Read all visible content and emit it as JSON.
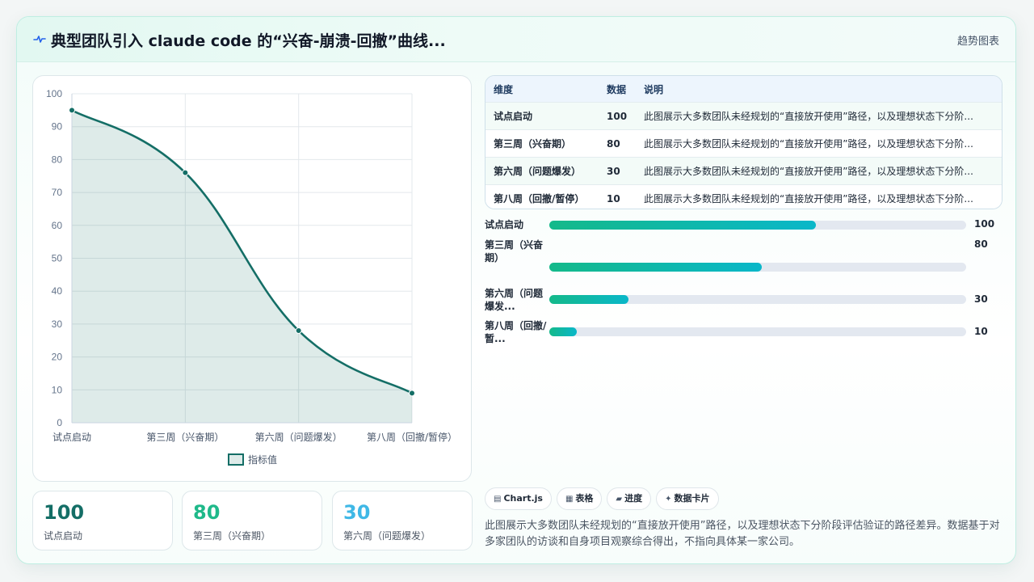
{
  "header": {
    "title": "典型团队引入 claude code 的“兴奋-崩溃-回撤”曲线...",
    "tag": "趋势图表",
    "icon": "pulse-icon"
  },
  "chart_data": {
    "type": "line",
    "fill": "area",
    "categories": [
      "试点启动",
      "第三周（兴奋期）",
      "第六周（问题爆发）",
      "第八周（回撤/暂停）"
    ],
    "series": [
      {
        "name": "指标值",
        "values": [
          95,
          76,
          28,
          9
        ],
        "color": "#146e66"
      }
    ],
    "ylim": [
      0,
      100
    ],
    "yticks": [
      0,
      10,
      20,
      30,
      40,
      50,
      60,
      70,
      80,
      90,
      100
    ],
    "grid": true,
    "legend": "bottom",
    "legend_label": "指标值"
  },
  "stats": [
    {
      "value": "100",
      "label": "试点启动",
      "color": "#146e66"
    },
    {
      "value": "80",
      "label": "第三周（兴奋期）",
      "color": "#1fb98a"
    },
    {
      "value": "30",
      "label": "第六周（问题爆发）",
      "color": "#3fb8e6"
    }
  ],
  "table": {
    "headers": [
      "维度",
      "数据",
      "说明"
    ],
    "rows": [
      [
        "试点启动",
        "100",
        "此图展示大多数团队未经规划的“直接放开使用”路径，以及理想状态下分阶..."
      ],
      [
        "第三周（兴奋期）",
        "80",
        "此图展示大多数团队未经规划的“直接放开使用”路径，以及理想状态下分阶..."
      ],
      [
        "第六周（问题爆发）",
        "30",
        "此图展示大多数团队未经规划的“直接放开使用”路径，以及理想状态下分阶..."
      ],
      [
        "第八周（回撤/暂停）",
        "10",
        "此图展示大多数团队未经规划的“直接放开使用”路径，以及理想状态下分阶..."
      ]
    ]
  },
  "progress": {
    "max": 100,
    "items": [
      {
        "label": "试点启动",
        "value": 100,
        "display": "100"
      },
      {
        "label": "第三周（兴奋期）",
        "value": 80,
        "display": "80"
      },
      {
        "label": "第六周（问题爆发...",
        "value": 30,
        "display": "30"
      },
      {
        "label": "第八周（回撤/暂...",
        "value": 10,
        "display": "10"
      }
    ]
  },
  "chips": [
    {
      "icon": "▤",
      "label": "Chart.js"
    },
    {
      "icon": "▦",
      "label": "表格"
    },
    {
      "icon": "▰",
      "label": "进度"
    },
    {
      "icon": "✦",
      "label": "数据卡片"
    }
  ],
  "description": "此图展示大多数团队未经规划的“直接放开使用”路径，以及理想状态下分阶段评估验证的路径差异。数据基于对多家团队的访谈和自身项目观察综合得出，不指向具体某一家公司。"
}
